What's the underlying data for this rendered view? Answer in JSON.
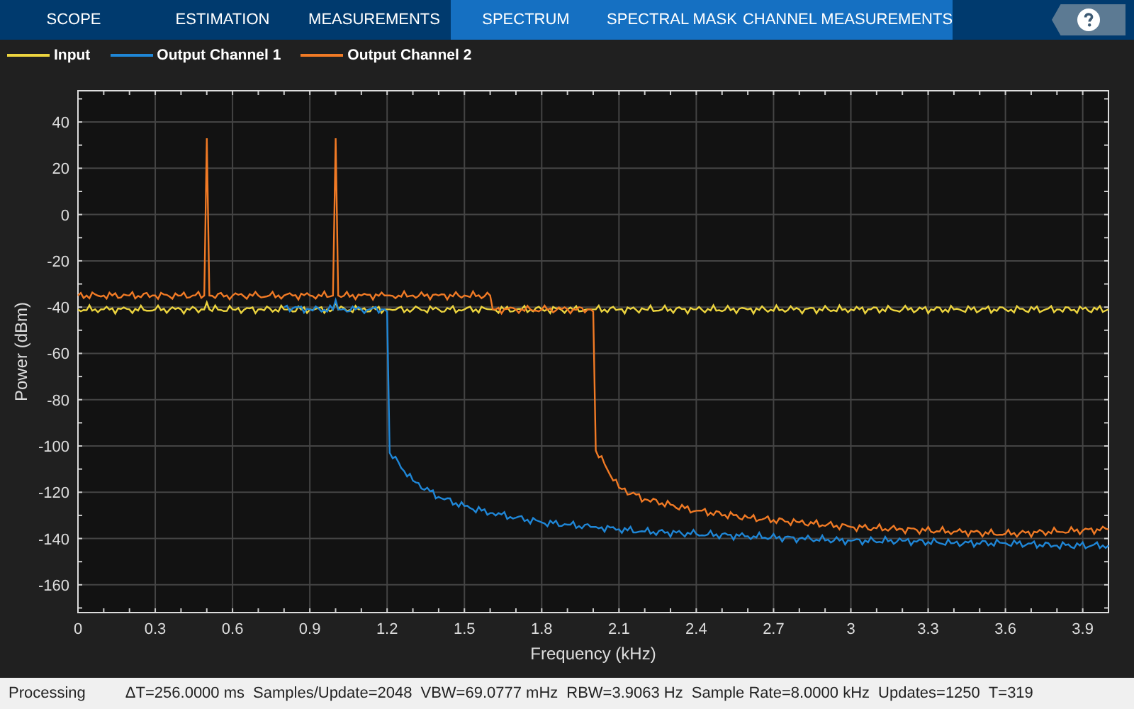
{
  "tabs": [
    {
      "label": "SCOPE",
      "contextual": false
    },
    {
      "label": "ESTIMATION",
      "contextual": false
    },
    {
      "label": "MEASUREMENTS",
      "contextual": false
    },
    {
      "label": "SPECTRUM",
      "contextual": true
    },
    {
      "label": "SPECTRAL MASK",
      "contextual": true
    },
    {
      "label": "CHANNEL MEASUREMENTS",
      "contextual": true
    }
  ],
  "chart": {
    "chart_data": {
      "type": "line",
      "xlabel": "Frequency (kHz)",
      "ylabel": "Power (dBm)",
      "x": [
        0,
        0.1,
        0.2,
        0.3,
        0.4,
        0.49,
        0.5,
        0.51,
        0.6,
        0.7,
        0.8,
        0.9,
        0.99,
        1.0,
        1.01,
        1.1,
        1.19,
        1.2,
        1.21,
        1.3,
        1.4,
        1.5,
        1.6,
        1.61,
        1.7,
        1.8,
        1.9,
        1.99,
        2.0,
        2.01,
        2.1,
        2.2,
        2.4,
        2.6,
        2.8,
        3.0,
        3.2,
        3.4,
        3.6,
        3.8,
        4.0
      ],
      "series": [
        {
          "name": "Input",
          "color": "#ecd43f",
          "values": [
            -41,
            -41,
            -41,
            -41,
            -41,
            -41,
            -38,
            -41,
            -41,
            -41,
            -41,
            -41,
            -41,
            -38,
            -41,
            -41,
            -41,
            -41,
            -41,
            -41,
            -41,
            -41,
            -41,
            -41,
            -41,
            -41,
            -41,
            -41,
            -41,
            -41,
            -41,
            -41,
            -41,
            -41,
            -41,
            -41,
            -41,
            -41,
            -41,
            -41,
            -41
          ]
        },
        {
          "name": "Output Channel 1",
          "color": "#1f86d6",
          "values": [
            null,
            null,
            null,
            null,
            null,
            null,
            null,
            null,
            null,
            null,
            -40,
            -41,
            -41,
            -37,
            -41,
            -41,
            -41,
            -42,
            -103,
            -115,
            -122,
            -126,
            -129,
            -129,
            -131,
            -133,
            -134,
            -135,
            -135,
            -135,
            -136,
            -137,
            -138,
            -139,
            -140,
            -141,
            -141,
            -142,
            -142,
            -143,
            -143
          ]
        },
        {
          "name": "Output Channel 2",
          "color": "#f07a25",
          "values": [
            -35,
            -35,
            -35,
            -35,
            -35,
            -35,
            33,
            -35,
            -35,
            -35,
            -35,
            -35,
            -35,
            33,
            -35,
            -35,
            -35,
            -35,
            -35,
            -35,
            -35,
            -35,
            -35,
            -41,
            -41,
            -41,
            -41,
            -41,
            -42,
            -102,
            -118,
            -123,
            -128,
            -131,
            -133,
            -135,
            -136,
            -137,
            -138,
            -137,
            -136
          ]
        }
      ],
      "grid": true,
      "xlim": [
        0,
        4.0
      ],
      "ylim": [
        -172,
        53.5
      ],
      "xticks": [
        0,
        0.3,
        0.6,
        0.9,
        1.2,
        1.5,
        1.8,
        2.1,
        2.4,
        2.7,
        3,
        3.3,
        3.6,
        3.9
      ],
      "yticks": [
        40,
        20,
        0,
        -20,
        -40,
        -60,
        -80,
        -100,
        -120,
        -140,
        -160
      ]
    }
  },
  "status_bar": {
    "state": "Processing",
    "items": [
      "ΔT=256.0000 ms",
      "Samples/Update=2048",
      "VBW=69.0777 mHz",
      "RBW=3.9063 Hz",
      "Sample Rate=8.0000 kHz",
      "Updates=1250",
      "T=319"
    ]
  }
}
